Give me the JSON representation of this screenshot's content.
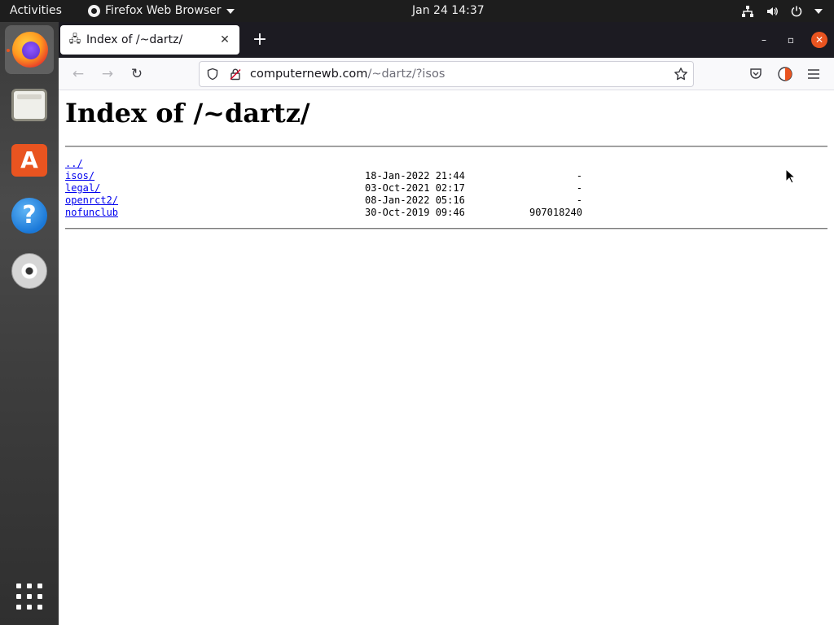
{
  "topbar": {
    "activities": "Activities",
    "app_name": "Firefox Web Browser",
    "clock": "Jan 24  14:37"
  },
  "dock": {
    "items": [
      "firefox-icon",
      "files-icon",
      "software-icon",
      "help-icon",
      "disc-icon",
      "show-apps-icon"
    ],
    "software_glyph": "A",
    "help_glyph": "?"
  },
  "browser": {
    "tab_title": "Index of /~dartz/",
    "tab_close": "✕",
    "new_tab": "+",
    "url_host": "computernewb.com",
    "url_path": "/~dartz/?isos",
    "back": "←",
    "forward": "→",
    "reload": "↻",
    "win_min": "–",
    "win_max": "▫",
    "win_close": "✕"
  },
  "page": {
    "title": "Index of /~dartz/",
    "entries": [
      {
        "name": "../",
        "date": "",
        "size": ""
      },
      {
        "name": "isos/",
        "date": "18-Jan-2022 21:44",
        "size": "-"
      },
      {
        "name": "legal/",
        "date": "03-Oct-2021 02:17",
        "size": "-"
      },
      {
        "name": "openrct2/",
        "date": "08-Jan-2022 05:16",
        "size": "-"
      },
      {
        "name": "nofunclub",
        "date": "30-Oct-2019 09:46",
        "size": "907018240"
      }
    ]
  },
  "colors": {
    "accent": "#e95420",
    "link": "#0000ee",
    "tabbar": "#1c1b22"
  }
}
